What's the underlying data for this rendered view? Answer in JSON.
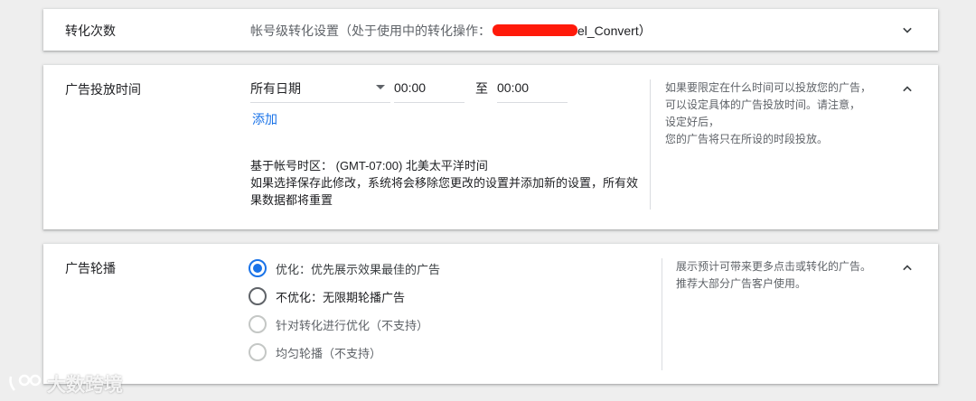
{
  "conversion_card": {
    "title": "转化次数",
    "summary_prefix": "帐号级转化设置（处于使用中的转化操作：",
    "summary_suffix": "el_Convert）"
  },
  "schedule_card": {
    "title": "广告投放时间",
    "date_select_value": "所有日期",
    "start_time": "00:00",
    "to_label": "至",
    "end_time": "00:00",
    "add_link": "添加",
    "tz_note_line1": "基于帐号时区： (GMT-07:00) 北美太平洋时间",
    "tz_note_line2": "如果选择保存此修改，系统将会移除您更改的设置并添加新的设置，所有效果数据都将重置",
    "help_lines": [
      "如果要限定在什么时间可以投放您的广告，",
      "可以设定具体的广告投放时间。请注意，",
      "设定好后，",
      "您的广告将只在所设的时段投放。"
    ]
  },
  "rotation_card": {
    "title": "广告轮播",
    "options": [
      {
        "label": "优化：优先展示效果最佳的广告",
        "state": "checked"
      },
      {
        "label": "不优化：无限期轮播广告",
        "state": "unchecked"
      },
      {
        "label": "针对转化进行优化（不支持）",
        "state": "disabled"
      },
      {
        "label": "均匀轮播（不支持）",
        "state": "disabled"
      }
    ],
    "help_lines": [
      "展示预计可带来更多点击或转化的广告。",
      "推荐大部分广告客户使用。"
    ]
  },
  "watermark": {
    "text": "大数跨境"
  },
  "colors": {
    "accent": "#1a73e8",
    "redaction": "#ff1a0a",
    "page_bg": "#eeeeee"
  },
  "icons": {
    "collapse": "chevron-up-icon",
    "expand": "chevron-down-icon",
    "dropdown": "caret-down-icon",
    "watermark_logo": "watermark-logo-icon"
  }
}
